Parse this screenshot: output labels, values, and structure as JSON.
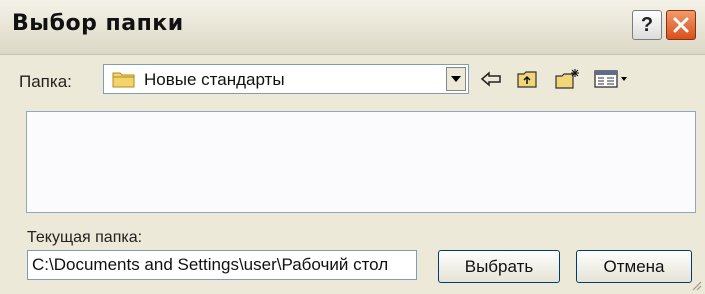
{
  "window": {
    "title": "Выбор папки",
    "help_label": "?"
  },
  "folder_bar": {
    "label": "Папка:",
    "selected_folder": "Новые стандарты",
    "tools": [
      "back-icon",
      "up-folder-icon",
      "new-folder-icon",
      "view-menu-icon"
    ]
  },
  "current": {
    "label": "Текущая папка:",
    "path": "C:\\Documents and Settings\\user\\Рабочий стол"
  },
  "buttons": {
    "select": "Выбрать",
    "cancel": "Отмена"
  },
  "colors": {
    "title_bar": "#e6e3d4",
    "close_button": "#d8501b",
    "button_border": "#003c74",
    "field_border": "#7f9db9"
  }
}
